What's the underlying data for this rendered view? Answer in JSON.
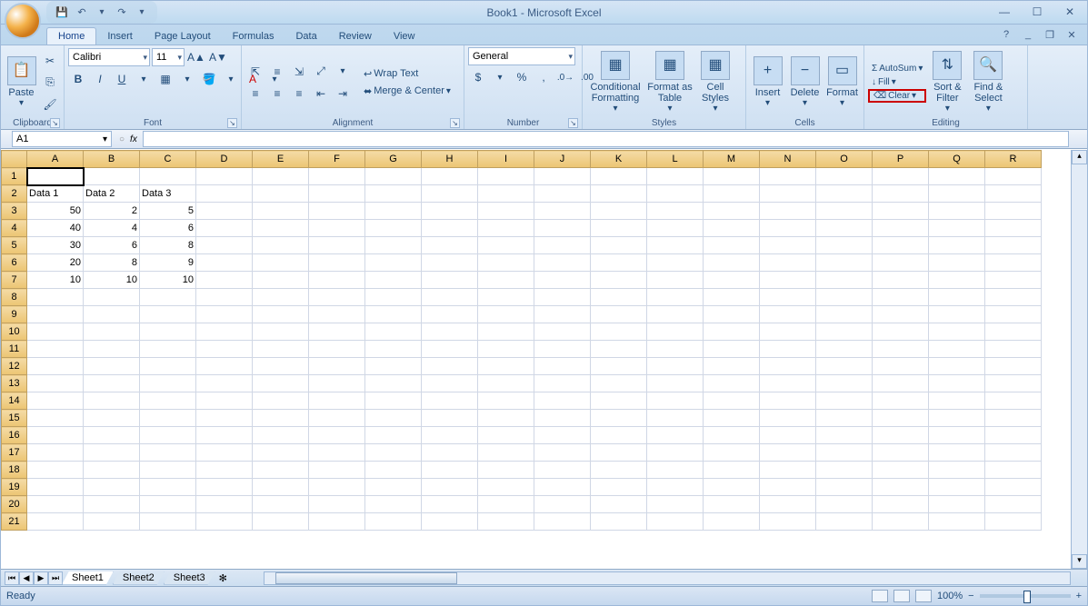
{
  "title": "Book1 - Microsoft Excel",
  "qat": {
    "save": "💾",
    "undo": "↶",
    "redo": "↷"
  },
  "tabs": [
    "Home",
    "Insert",
    "Page Layout",
    "Formulas",
    "Data",
    "Review",
    "View"
  ],
  "active_tab": 0,
  "ribbon": {
    "clipboard": {
      "paste": "Paste",
      "label": "Clipboard"
    },
    "font": {
      "name": "Calibri",
      "size": "11",
      "label": "Font",
      "bold": "B",
      "italic": "I",
      "underline": "U"
    },
    "alignment": {
      "wrap": "Wrap Text",
      "merge": "Merge & Center",
      "label": "Alignment"
    },
    "number": {
      "format": "General",
      "label": "Number",
      "currency": "$",
      "percent": "%",
      "comma": ",",
      "inc": ".0",
      "dec": ".00"
    },
    "styles": {
      "cond": "Conditional Formatting",
      "table": "Format as Table",
      "cell": "Cell Styles",
      "label": "Styles"
    },
    "cells": {
      "insert": "Insert",
      "delete": "Delete",
      "format": "Format",
      "label": "Cells"
    },
    "editing": {
      "autosum": "AutoSum",
      "fill": "Fill",
      "clear": "Clear",
      "sort": "Sort & Filter",
      "find": "Find & Select",
      "label": "Editing"
    }
  },
  "namebox": "A1",
  "columns": [
    "A",
    "B",
    "C",
    "D",
    "E",
    "F",
    "G",
    "H",
    "I",
    "J",
    "K",
    "L",
    "M",
    "N",
    "O",
    "P",
    "Q",
    "R"
  ],
  "row_count": 21,
  "selected_cell": "A1",
  "cells": {
    "A2": "Data 1",
    "B2": "Data 2",
    "C2": "Data 3",
    "A3": "50",
    "B3": "2",
    "C3": "5",
    "A4": "40",
    "B4": "4",
    "C4": "6",
    "A5": "30",
    "B5": "6",
    "C5": "8",
    "A6": "20",
    "B6": "8",
    "C6": "9",
    "A7": "10",
    "B7": "10",
    "C7": "10"
  },
  "chart_data": {
    "type": "table",
    "title": "",
    "series": [
      {
        "name": "Data 1",
        "values": [
          50,
          40,
          30,
          20,
          10
        ]
      },
      {
        "name": "Data 2",
        "values": [
          2,
          4,
          6,
          8,
          10
        ]
      },
      {
        "name": "Data 3",
        "values": [
          5,
          6,
          8,
          9,
          10
        ]
      }
    ]
  },
  "sheets": [
    "Sheet1",
    "Sheet2",
    "Sheet3"
  ],
  "active_sheet": 0,
  "status": "Ready",
  "zoom": "100%"
}
